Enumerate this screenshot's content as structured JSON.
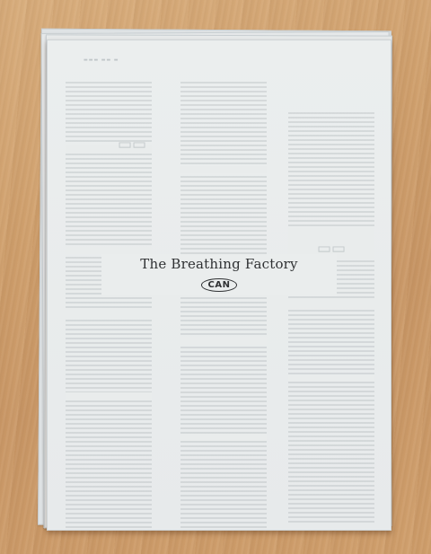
{
  "document": {
    "title": "The Breathing Factory",
    "logo_text": "CAN"
  },
  "colors": {
    "table": "#cf9f6c",
    "paper": "#e9ecec",
    "ink": "#2f3133"
  }
}
